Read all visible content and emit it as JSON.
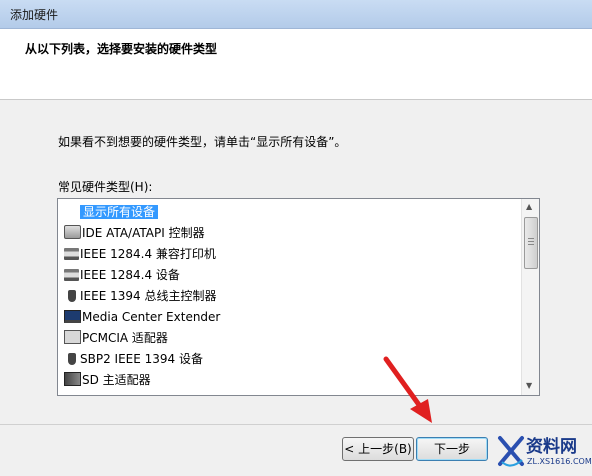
{
  "window": {
    "title": "添加硬件"
  },
  "header": {
    "heading": "从以下列表，选择要安装的硬件类型"
  },
  "info": {
    "text": "如果看不到想要的硬件类型，请单击“显示所有设备”。"
  },
  "list": {
    "label": "常见硬件类型(H):",
    "items": [
      {
        "label": "显示所有设备",
        "icon": "none",
        "selected": true
      },
      {
        "label": "IDE ATA/ATAPI 控制器",
        "icon": "drive-controller-icon"
      },
      {
        "label": "IEEE 1284.4 兼容打印机",
        "icon": "printer-icon"
      },
      {
        "label": "IEEE 1284.4 设备",
        "icon": "printer-icon"
      },
      {
        "label": "IEEE 1394 总线主控制器",
        "icon": "plug-icon"
      },
      {
        "label": "Media Center Extender",
        "icon": "monitor-icon"
      },
      {
        "label": "PCMCIA 适配器",
        "icon": "card-icon"
      },
      {
        "label": "SBP2 IEEE 1394 设备",
        "icon": "plug-icon"
      },
      {
        "label": "SD 主适配器",
        "icon": "sd-card-icon"
      }
    ]
  },
  "buttons": {
    "back": "< 上一步(B)",
    "next": "下一步"
  },
  "watermark": {
    "text": "资料网",
    "url": "ZL.XS1616.COM"
  },
  "colors": {
    "selection": "#3399ff",
    "annotation_arrow": "#e02020"
  }
}
